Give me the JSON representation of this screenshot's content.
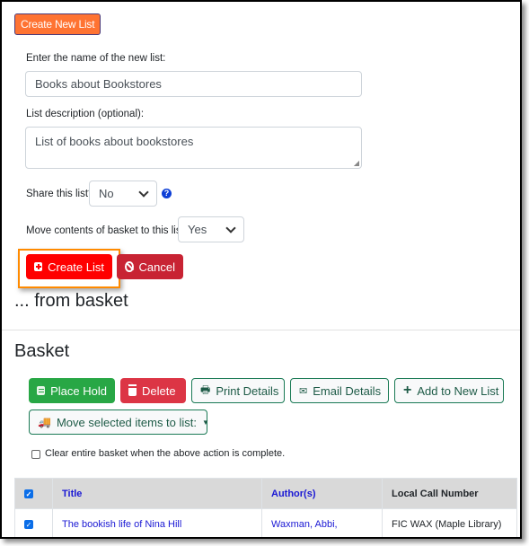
{
  "create_new_list_button": "Create New List",
  "form": {
    "name_label": "Enter the name of the new list:",
    "name_value": "Books about Bookstores",
    "description_label": "List description (optional):",
    "description_value": "List of books about bookstores",
    "share_label": "Share this list?",
    "share_value": "No",
    "move_label": "Move contents of basket to this list?",
    "move_value": "Yes",
    "create_button": "Create List",
    "cancel_button": "Cancel"
  },
  "from_basket_heading": "... from basket",
  "basket": {
    "heading": "Basket",
    "actions": {
      "place_hold": "Place Hold",
      "delete": "Delete",
      "print_details": "Print Details",
      "email_details": "Email Details",
      "add_to_new_list": "Add to New List",
      "move_selected": "Move selected items to list:"
    },
    "clear_basket_label": "Clear entire basket when the above action is complete.",
    "clear_basket_checked": false,
    "table": {
      "columns": [
        "Title",
        "Author(s)",
        "Local Call Number"
      ],
      "select_all_checked": true,
      "rows": [
        {
          "checked": true,
          "title": "The bookish life of Nina Hill",
          "author": "Waxman, Abbi,",
          "call_number": "FIC WAX (Maple Library)"
        }
      ]
    }
  },
  "colors": {
    "create_new_list": "#ff7332",
    "create_list": "#ff0000",
    "cancel": "#c82333",
    "place_hold": "#28a745",
    "delete": "#dc3545",
    "outline": "#1a7a55",
    "highlight": "#ff8a00",
    "link": "#1a18d4"
  }
}
